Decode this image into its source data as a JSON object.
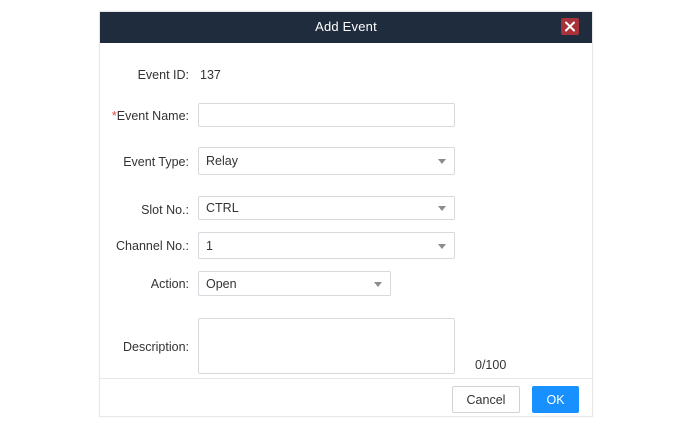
{
  "dialog": {
    "title": "Add Event",
    "close_icon": "close-icon"
  },
  "form": {
    "event_id": {
      "label": "Event ID:",
      "value": "137"
    },
    "event_name": {
      "required_mark": "*",
      "label": "Event Name:",
      "value": ""
    },
    "event_type": {
      "label": "Event Type:",
      "selected": "Relay"
    },
    "slot_no": {
      "label": "Slot No.:",
      "selected": "CTRL"
    },
    "channel_no": {
      "label": "Channel No.:",
      "selected": "1"
    },
    "action": {
      "label": "Action:",
      "selected": "Open"
    },
    "description": {
      "label": "Description:",
      "value": "",
      "counter": "0/100"
    }
  },
  "footer": {
    "cancel_label": "Cancel",
    "ok_label": "OK"
  },
  "colors": {
    "titlebar": "#1f2c3e",
    "close_button": "#a9323a",
    "primary": "#1890ff",
    "required": "#e64545"
  }
}
